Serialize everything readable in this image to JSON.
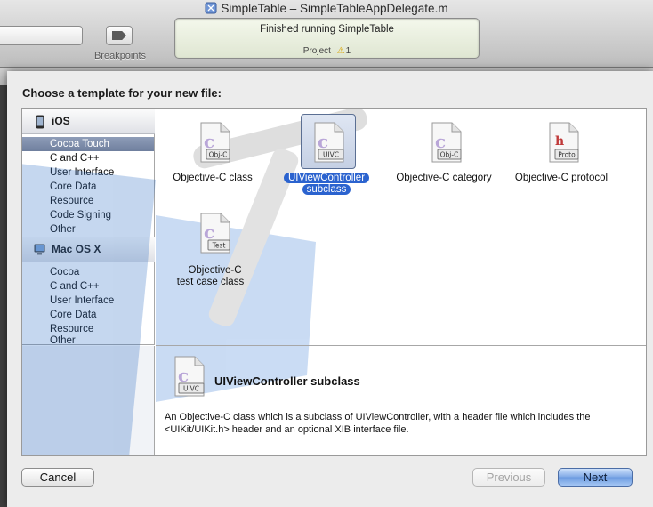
{
  "window": {
    "title": "SimpleTable – SimpleTableAppDelegate.m"
  },
  "toolbar": {
    "breakpoints_label": "Breakpoints",
    "activity": {
      "status": "Finished running SimpleTable",
      "project_label": "Project",
      "warning_count": "1"
    }
  },
  "sheet": {
    "title": "Choose a template for your new file:",
    "sidebar": {
      "groups": [
        {
          "label": "iOS",
          "icon": "iphone-icon",
          "items": [
            "Cocoa Touch",
            "C and C++",
            "User Interface",
            "Core Data",
            "Resource",
            "Code Signing",
            "Other"
          ],
          "selected_index": 0
        },
        {
          "label": "Mac OS X",
          "icon": "mac-icon",
          "items": [
            "Cocoa",
            "C and C++",
            "User Interface",
            "Core Data",
            "Resource",
            "Other"
          ]
        }
      ]
    },
    "templates": [
      {
        "name": "Objective-C class",
        "badge": "Obj-C",
        "icon": "objc-class-file-icon"
      },
      {
        "name": "UIViewController subclass",
        "badge": "UIVC",
        "icon": "uivc-file-icon",
        "selected": true
      },
      {
        "name": "Objective-C category",
        "badge": "Obj-C",
        "icon": "objc-category-file-icon"
      },
      {
        "name": "Objective-C protocol",
        "badge": "Proto",
        "icon": "protocol-file-icon"
      },
      {
        "name": "Objective-C test case class",
        "badge": "Test",
        "icon": "test-file-icon"
      }
    ],
    "description": {
      "title": "UIViewController subclass",
      "badge": "UIVC",
      "text": "An Objective-C class which is a subclass of UIViewController, with a header file which includes the <UIKit/UIKit.h> header and an optional XIB interface file."
    },
    "buttons": {
      "cancel": "Cancel",
      "previous": "Previous",
      "next": "Next"
    }
  },
  "colors": {
    "selection_blue": "#2b63cf",
    "sidebar_selection": "#7a89a6",
    "default_button": "#6b9ae0"
  }
}
